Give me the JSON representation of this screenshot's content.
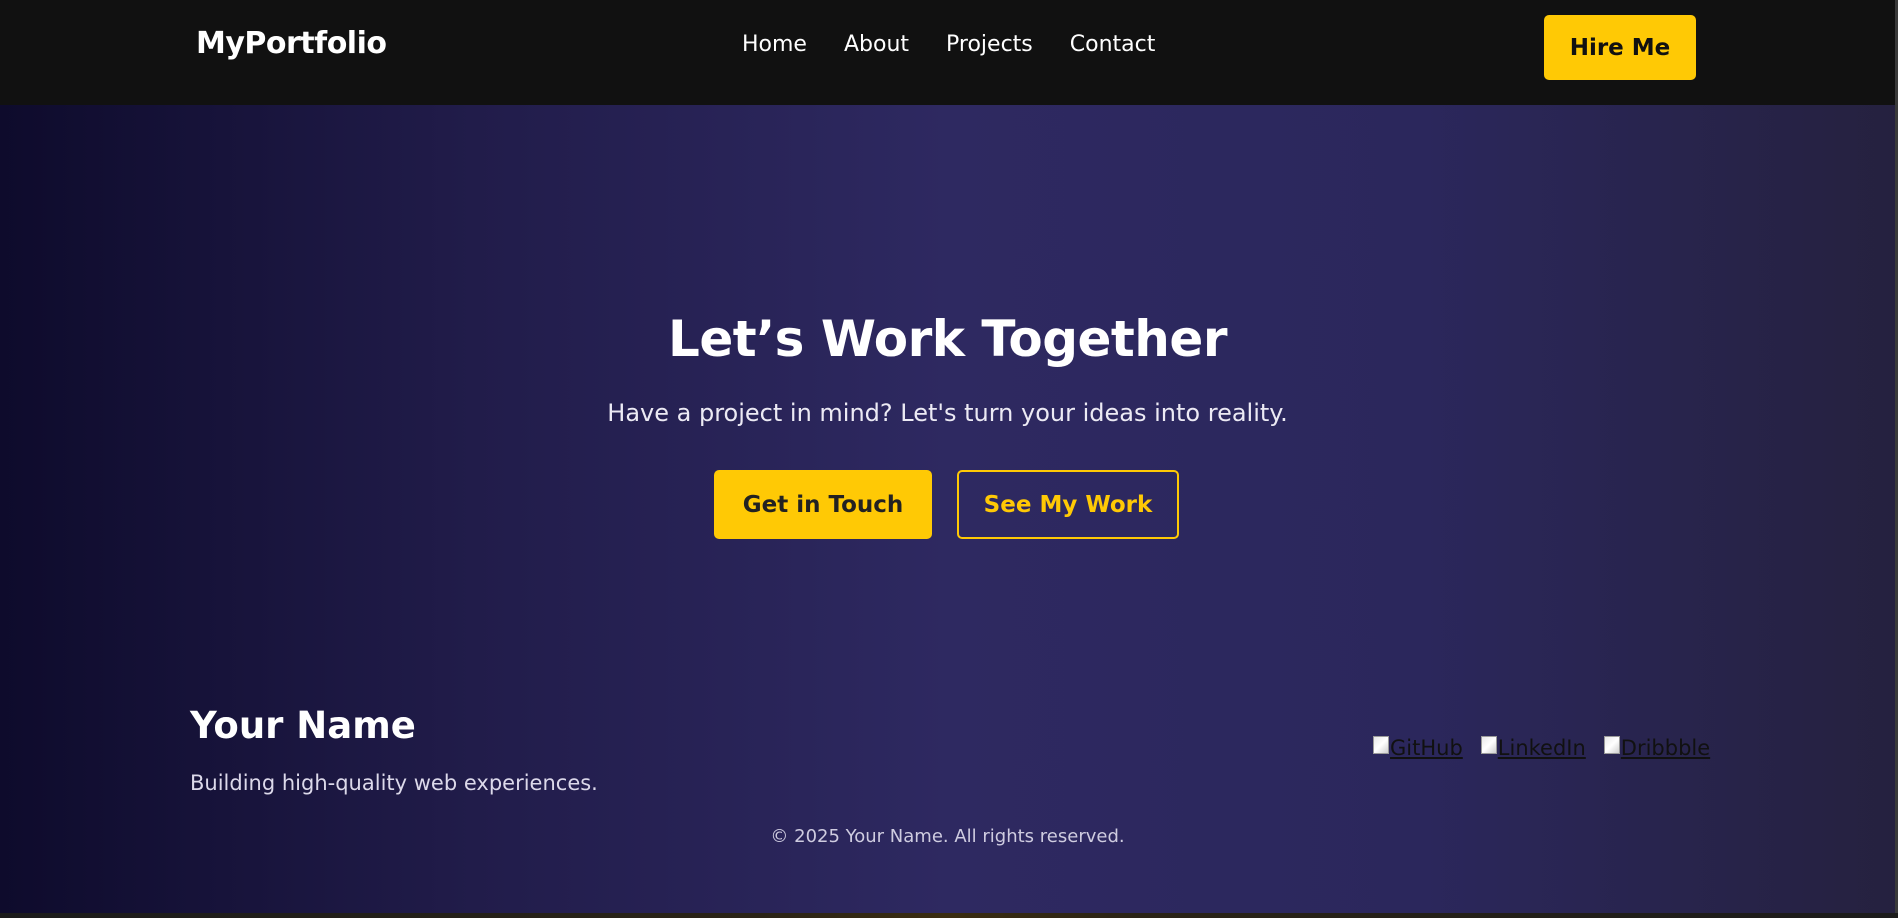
{
  "navbar": {
    "brand": "MyPortfolio",
    "links": [
      "Home",
      "About",
      "Projects",
      "Contact"
    ],
    "cta": "Hire Me"
  },
  "hero": {
    "title": "Let’s Work Together",
    "subtitle": "Have a project in mind? Let's turn your ideas into reality.",
    "primary_button": "Get in Touch",
    "secondary_button": "See My Work"
  },
  "footer": {
    "name": "Your Name",
    "tagline": "Building high-quality web experiences.",
    "socials": [
      "GitHub",
      "LinkedIn",
      "Dribbble"
    ],
    "copyright": "© 2025 Your Name. All rights reserved."
  },
  "colors": {
    "accent": "#ffc905",
    "navbar_bg": "#111111",
    "hero_bg_dark": "#0e0b2c",
    "hero_bg_mid": "#2e2961"
  },
  "icons": {
    "social_image": "broken-image-icon"
  }
}
